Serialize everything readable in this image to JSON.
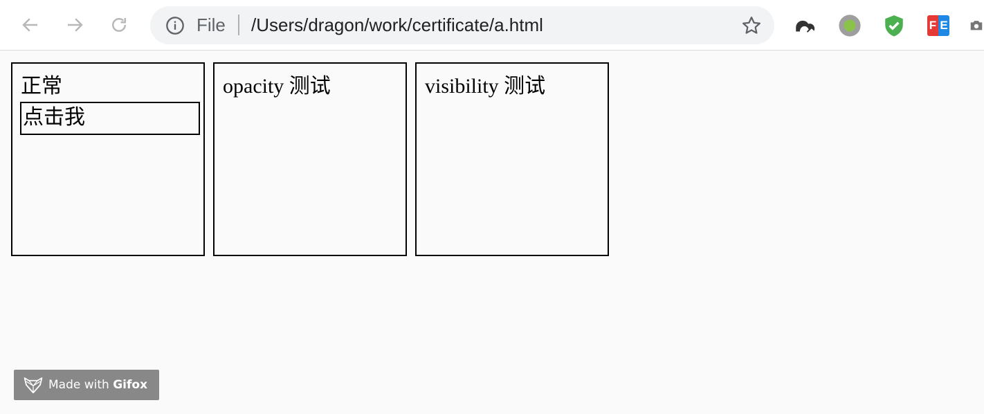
{
  "browser": {
    "scheme_label": "File",
    "url": "/Users/dragon/work/certificate/a.html",
    "extensions": [
      "cloud-sync-icon",
      "green-dot-icon",
      "shield-check-icon",
      "fe-helper-icon",
      "camera-icon"
    ],
    "fe_badge": {
      "f": "F",
      "e": "E"
    }
  },
  "boxes": [
    {
      "title": "正常",
      "button_label": "点击我"
    },
    {
      "title": "opacity 测试"
    },
    {
      "title": "visibility 测试"
    }
  ],
  "watermark": {
    "prefix": "Made with ",
    "brand": "Gifox"
  }
}
